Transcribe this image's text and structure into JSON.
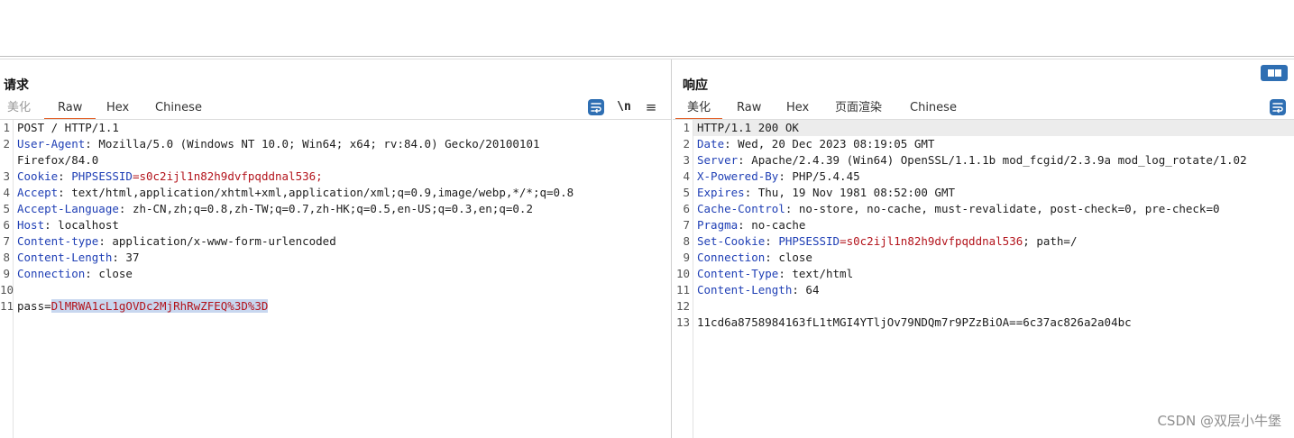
{
  "request": {
    "title": "请求",
    "tabs": [
      "美化",
      "Raw",
      "Hex",
      "Chinese"
    ],
    "newline_label": "\\n",
    "menu_label": "≡",
    "lines": [
      {
        "n": "1",
        "k": "",
        "sep": "",
        "v": "POST / HTTP/1.1"
      },
      {
        "n": "2",
        "k": "User-Agent",
        "sep": ": ",
        "v": "Mozilla/5.0 (Windows NT 10.0; Win64; x64; rv:84.0) Gecko/20100101"
      },
      {
        "n": "",
        "k": "",
        "sep": "",
        "v": "Firefox/84.0"
      },
      {
        "n": "3",
        "k": "Cookie",
        "sep": ": ",
        "ck": "PHPSESSID",
        "cv": "s0c2ijl1n82h9dvfpqddnal536;"
      },
      {
        "n": "4",
        "k": "Accept",
        "sep": ": ",
        "v": "text/html,application/xhtml+xml,application/xml;q=0.9,image/webp,*/*;q=0.8"
      },
      {
        "n": "5",
        "k": "Accept-Language",
        "sep": ": ",
        "v": "zh-CN,zh;q=0.8,zh-TW;q=0.7,zh-HK;q=0.5,en-US;q=0.3,en;q=0.2"
      },
      {
        "n": "6",
        "k": "Host",
        "sep": ": ",
        "v": "localhost"
      },
      {
        "n": "7",
        "k": "Content-type",
        "sep": ": ",
        "v": "application/x-www-form-urlencoded"
      },
      {
        "n": "8",
        "k": "Content-Length",
        "sep": ": ",
        "v": "37"
      },
      {
        "n": "9",
        "k": "Connection",
        "sep": ": ",
        "v": "close"
      },
      {
        "n": "10",
        "k": "",
        "sep": "",
        "v": ""
      },
      {
        "n": "11",
        "pk": "pass",
        "pv": "DlMRWA1cL1gOVDc2MjRhRwZFEQ%3D%3D"
      }
    ]
  },
  "response": {
    "title": "响应",
    "tabs": [
      "美化",
      "Raw",
      "Hex",
      "页面渲染",
      "Chinese"
    ],
    "lines": [
      {
        "n": "1",
        "k": "",
        "sep": "",
        "v": "HTTP/1.1 200 OK"
      },
      {
        "n": "2",
        "k": "Date",
        "sep": ": ",
        "v": "Wed, 20 Dec 2023 08:19:05 GMT"
      },
      {
        "n": "3",
        "k": "Server",
        "sep": ": ",
        "v": "Apache/2.4.39 (Win64) OpenSSL/1.1.1b mod_fcgid/2.3.9a mod_log_rotate/1.02"
      },
      {
        "n": "4",
        "k": "X-Powered-By",
        "sep": ": ",
        "v": "PHP/5.4.45"
      },
      {
        "n": "5",
        "k": "Expires",
        "sep": ": ",
        "v": "Thu, 19 Nov 1981 08:52:00 GMT"
      },
      {
        "n": "6",
        "k": "Cache-Control",
        "sep": ": ",
        "v": "no-store, no-cache, must-revalidate, post-check=0, pre-check=0"
      },
      {
        "n": "7",
        "k": "Pragma",
        "sep": ": ",
        "v": "no-cache"
      },
      {
        "n": "8",
        "k": "Set-Cookie",
        "sep": ": ",
        "ck": "PHPSESSID",
        "cv": "s0c2ijl1n82h9dvfpqddnal536",
        "tail": "; path=/"
      },
      {
        "n": "9",
        "k": "Connection",
        "sep": ": ",
        "v": "close"
      },
      {
        "n": "10",
        "k": "Content-Type",
        "sep": ": ",
        "v": "text/html"
      },
      {
        "n": "11",
        "k": "Content-Length",
        "sep": ": ",
        "v": "64"
      },
      {
        "n": "12",
        "k": "",
        "sep": "",
        "v": ""
      },
      {
        "n": "13",
        "k": "",
        "sep": "",
        "v": "11cd6a8758984163fL1tMGI4YTljOv79NDQm7r9PZzBiOA==6c37ac826a2a04bc"
      }
    ]
  },
  "watermark": "CSDN @双层小牛堡"
}
